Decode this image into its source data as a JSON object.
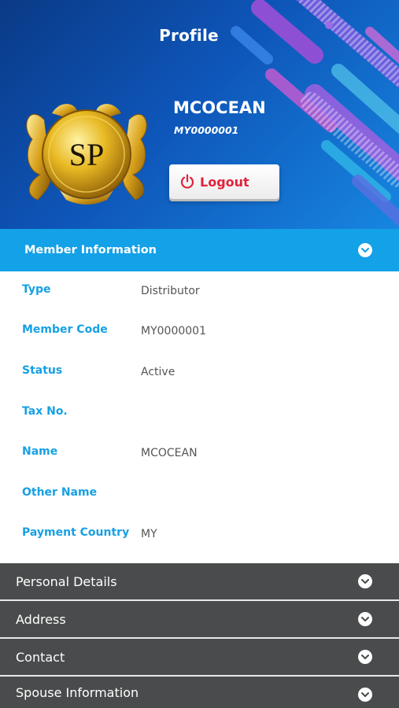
{
  "header": {
    "title": "Profile",
    "member_name": "MCOCEAN",
    "member_id": "MY0000001",
    "logout_label": "Logout",
    "logo_text": "SP"
  },
  "member_information": {
    "title": "Member Information",
    "rows": [
      {
        "label": "Type",
        "value": "Distributor"
      },
      {
        "label": "Member Code",
        "value": "MY0000001"
      },
      {
        "label": "Status",
        "value": "Active"
      },
      {
        "label": "Tax No.",
        "value": ""
      },
      {
        "label": "Name",
        "value": "MCOCEAN"
      },
      {
        "label": "Other Name",
        "value": ""
      },
      {
        "label": "Payment Country",
        "value": "MY"
      }
    ]
  },
  "sections": [
    {
      "title": "Personal Details"
    },
    {
      "title": "Address"
    },
    {
      "title": "Contact"
    },
    {
      "title": "Spouse Information"
    }
  ],
  "colors": {
    "accent_blue": "#13a1e8",
    "section_dark": "#4a4b4c",
    "logout_red": "#e0233c"
  },
  "icons": {
    "logout": "power-icon",
    "expand": "chevron-down-icon",
    "logo": "sp-crest-logo"
  }
}
